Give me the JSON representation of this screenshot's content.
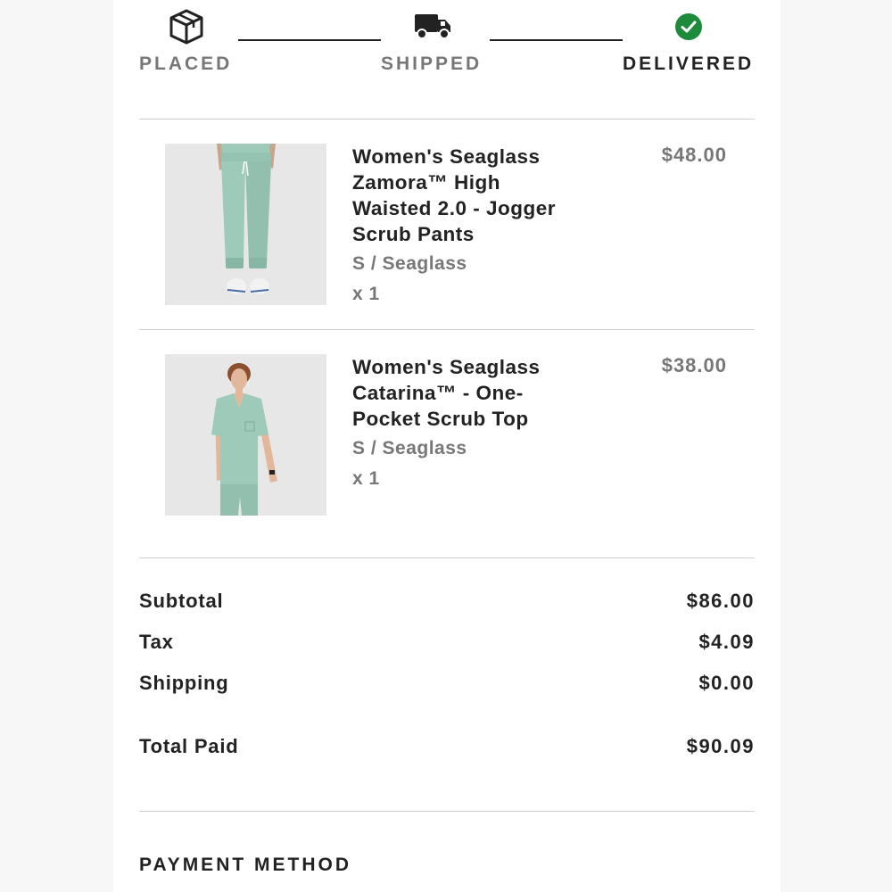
{
  "tracker": {
    "steps": [
      {
        "label": "PLACED",
        "icon": "box-icon",
        "state": "complete"
      },
      {
        "label": "SHIPPED",
        "icon": "truck-icon",
        "state": "complete"
      },
      {
        "label": "DELIVERED",
        "icon": "check-circle-icon",
        "state": "current"
      }
    ],
    "colors": {
      "check": "#1e8a3c",
      "line": "#222222"
    }
  },
  "items": [
    {
      "name": "Women's Seaglass Zamora™ High Waisted 2.0 - Jogger Scrub Pants",
      "variant": "S / Seaglass",
      "quantity": "x 1",
      "price": "$48.00",
      "image_icon": "scrub-pants-photo"
    },
    {
      "name": "Women's Seaglass Catarina™ - One-Pocket Scrub Top",
      "variant": "S / Seaglass",
      "quantity": "x 1",
      "price": "$38.00",
      "image_icon": "scrub-top-photo"
    }
  ],
  "summary": {
    "subtotal_label": "Subtotal",
    "subtotal_value": "$86.00",
    "tax_label": "Tax",
    "tax_value": "$4.09",
    "shipping_label": "Shipping",
    "shipping_value": "$0.00",
    "total_label": "Total Paid",
    "total_value": "$90.09"
  },
  "payment": {
    "heading": "PAYMENT METHOD"
  },
  "colors": {
    "seaglass": "#9dcab9",
    "text_primary": "#222222",
    "text_muted": "#777777"
  }
}
